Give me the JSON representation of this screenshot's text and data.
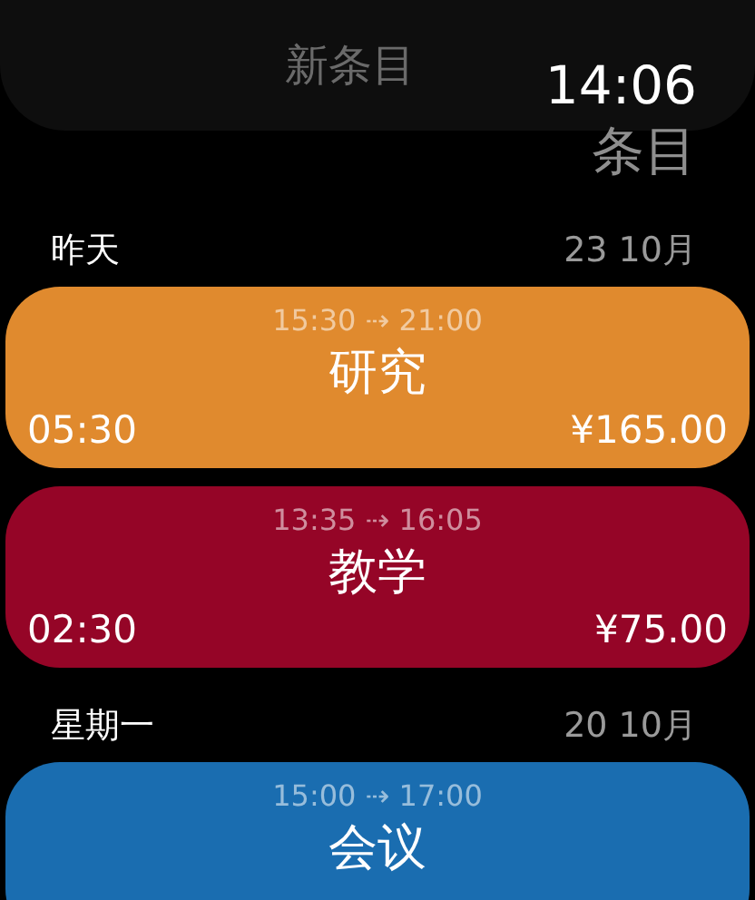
{
  "new_entry_button": {
    "label": "新条目"
  },
  "status": {
    "time": "14:06",
    "title": "条目"
  },
  "sections": [
    {
      "day": "昨天",
      "date": "23 10月",
      "entries": [
        {
          "range": "15:30 ⇢ 21:00",
          "title": "研究",
          "duration": "05:30",
          "amount": "¥165.00",
          "color": "#e08a2e"
        },
        {
          "range": "13:35 ⇢ 16:05",
          "title": "教学",
          "duration": "02:30",
          "amount": "¥75.00",
          "color": "#950527"
        }
      ]
    },
    {
      "day": "星期一",
      "date": "20 10月",
      "entries": [
        {
          "range": "15:00 ⇢ 17:00",
          "title": "会议",
          "color": "#1a6db0"
        }
      ]
    }
  ]
}
